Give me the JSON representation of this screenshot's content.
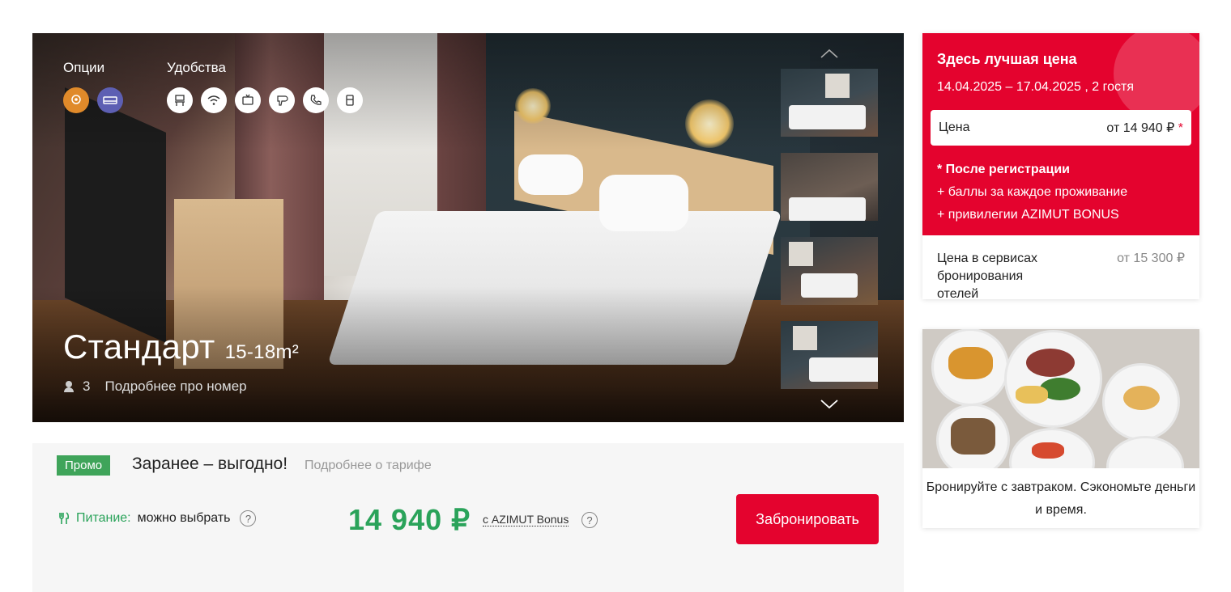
{
  "hero": {
    "options_label": "Опции",
    "amenities_label": "Удобства",
    "options_icons": [
      "pin-icon",
      "bed-icon"
    ],
    "amenities_icons": [
      "workdesk-icon",
      "wifi-icon",
      "tv-icon",
      "hairdryer-icon",
      "phone-icon",
      "fridge-icon"
    ],
    "room_name": "Стандарт",
    "room_area": "15-18m²",
    "guests": "3",
    "details_link": "Подробнее про номер",
    "active_thumb": 4
  },
  "tariff": {
    "promo_badge": "Промо",
    "name": "Заранее – выгодно!",
    "details_link": "Подробнее о тарифе",
    "meal_label": "Питание:",
    "meal_value": "можно выбрать",
    "help": "?",
    "price": "14 940 ₽",
    "bonus_link": "с AZIMUT Bonus",
    "book_button": "Забронировать"
  },
  "price_card": {
    "title": "Здесь лучшая цена",
    "dates": "14.04.2025 – 17.04.2025 , 2 гостя",
    "price_label": "Цена",
    "price_value": "от 14 940 ₽",
    "price_star": "*",
    "perk_1": "* После регистрации",
    "perk_2": "+ баллы за каждое проживание",
    "perk_3": "+ привилегии AZIMUT BONUS",
    "other_label": "Цена в сервисах бронирования отелей",
    "other_value": "от 15 300 ₽",
    "accent_color": "#e4032e"
  },
  "breakfast_card": {
    "caption": "Бронируйте с завтраком. Сэкономьте деньги и время."
  }
}
